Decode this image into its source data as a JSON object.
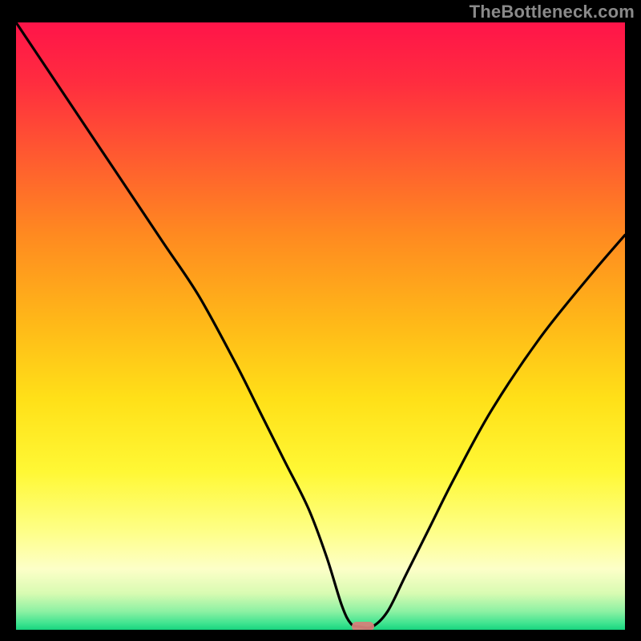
{
  "watermark": "TheBottleneck.com",
  "colors": {
    "frame": "#000000",
    "watermark": "#8a8a8a",
    "gradient_stops": [
      {
        "offset": 0.0,
        "color": "#ff1449"
      },
      {
        "offset": 0.1,
        "color": "#ff2d3f"
      },
      {
        "offset": 0.22,
        "color": "#ff5a30"
      },
      {
        "offset": 0.35,
        "color": "#ff8a20"
      },
      {
        "offset": 0.5,
        "color": "#ffba18"
      },
      {
        "offset": 0.62,
        "color": "#ffe018"
      },
      {
        "offset": 0.74,
        "color": "#fff835"
      },
      {
        "offset": 0.84,
        "color": "#feff89"
      },
      {
        "offset": 0.9,
        "color": "#fdffc8"
      },
      {
        "offset": 0.94,
        "color": "#d8fbb2"
      },
      {
        "offset": 0.97,
        "color": "#8cf1a3"
      },
      {
        "offset": 0.99,
        "color": "#3de38f"
      },
      {
        "offset": 1.0,
        "color": "#18d47e"
      }
    ],
    "curve": "#000000",
    "marker": "#d4817a"
  },
  "chart_data": {
    "type": "line",
    "title": "",
    "xlabel": "",
    "ylabel": "",
    "xlim": [
      0,
      100
    ],
    "ylim": [
      0,
      100
    ],
    "grid": false,
    "series": [
      {
        "name": "bottleneck-curve",
        "x": [
          0,
          8,
          16,
          24,
          30,
          36,
          40,
          44,
          48,
          51,
          53.5,
          55,
          56.5,
          58.5,
          61,
          64,
          68,
          72,
          78,
          86,
          94,
          100
        ],
        "values": [
          100,
          88,
          76,
          64,
          55,
          44,
          36,
          28,
          20,
          12,
          4,
          1,
          0.5,
          0.5,
          3,
          9,
          17,
          25,
          36,
          48,
          58,
          65
        ]
      }
    ],
    "flat_bottom": {
      "x_start": 55.5,
      "x_end": 58.5,
      "y": 0.5
    },
    "marker": {
      "x": 57,
      "y": 0.5
    }
  }
}
